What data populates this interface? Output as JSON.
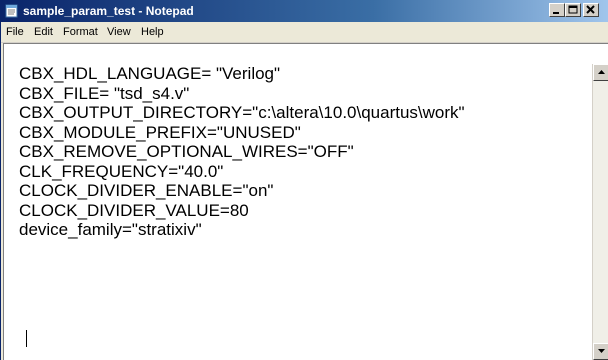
{
  "window": {
    "title": "sample_param_test - Notepad"
  },
  "menu": {
    "items": [
      {
        "label": "File"
      },
      {
        "label": "Edit"
      },
      {
        "label": "Format"
      },
      {
        "label": "View"
      },
      {
        "label": "Help"
      }
    ]
  },
  "document": {
    "lines": [
      "CBX_HDL_LANGUAGE= \"Verilog\"",
      "CBX_FILE= \"tsd_s4.v\"",
      "CBX_OUTPUT_DIRECTORY=\"c:\\altera\\10.0\\quartus\\work\"",
      "CBX_MODULE_PREFIX=\"UNUSED\"",
      "CBX_REMOVE_OPTIONAL_WIRES=\"OFF\"",
      "CLK_FREQUENCY=\"40.0\"",
      "CLOCK_DIVIDER_ENABLE=\"on\"",
      "CLOCK_DIVIDER_VALUE=80",
      "device_family=\"stratixiv\""
    ]
  },
  "icons": {
    "app": "notepad-icon",
    "minimize": "minimize-icon",
    "maximize": "maximize-icon",
    "close": "close-icon",
    "scroll_up": "arrow-up-icon",
    "scroll_down": "arrow-down-icon"
  },
  "colors": {
    "titlebar_start": "#0a246a",
    "titlebar_end": "#a6caf0",
    "title_text": "#ffffff",
    "menu_bg": "#ece9d8",
    "editor_bg": "#ffffff"
  }
}
